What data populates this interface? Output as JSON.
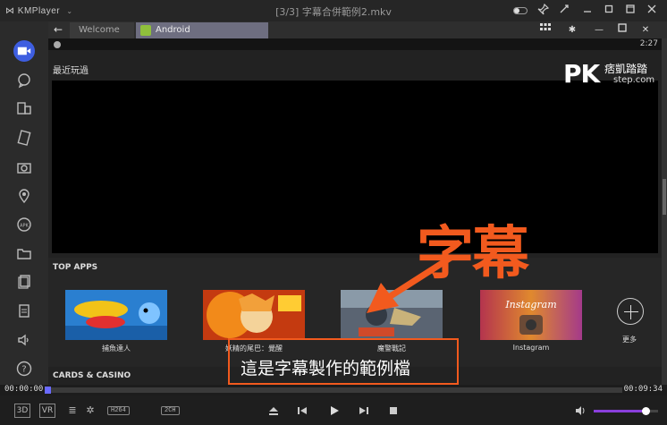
{
  "titlebar": {
    "app_name": "KMPlayer",
    "title": "[3/3] 字幕合併範例2.mkv"
  },
  "tabs": [
    {
      "label": "Welcome"
    },
    {
      "label": "Android"
    }
  ],
  "android": {
    "clock": "2:27",
    "recent_label": "最近玩過",
    "top_apps_label": "TOP APPS",
    "apps": [
      {
        "name": "捕魚達人"
      },
      {
        "name": "妖精的尾巴：覺醒"
      },
      {
        "name": "魔警戰記"
      },
      {
        "name": "Instagram"
      }
    ],
    "more_label": "更多",
    "cards_label": "CARDS & CASINO"
  },
  "watermark": {
    "logo": "PK",
    "chinese": "痞凱踏踏",
    "domain": "step.com"
  },
  "annotation": {
    "heading": "字幕",
    "subtitle": "這是字幕製作的範例檔"
  },
  "playback": {
    "current_time": "00:00:00",
    "total_time": "00:09:34",
    "progress": 0.0,
    "volume": 0.8
  },
  "control_bar": {
    "mode_3d": "3D",
    "mode_vr": "VR",
    "codec_badge": "H264",
    "channel_badge": "2CH"
  },
  "colors": {
    "accent": "#f25a1e",
    "volume": "#8a3fdc",
    "seek": "#6a6aff",
    "sidebar_active": "#3e5ee0"
  }
}
